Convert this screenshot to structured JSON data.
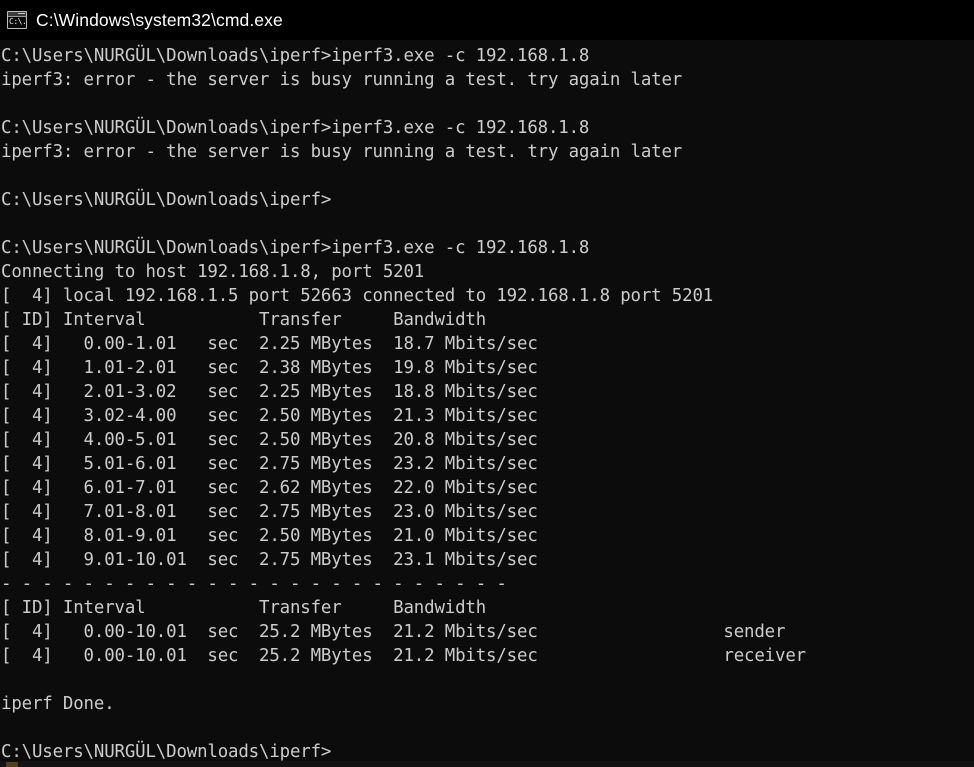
{
  "window": {
    "title": "C:\\Windows\\system32\\cmd.exe",
    "icon": "cmd-console-icon",
    "icon_glyph": "C:\\.",
    "titlebar_bg": "#000000",
    "console_bg": "#0c0c0c",
    "console_fg": "#cccccc"
  },
  "console": {
    "prompt": "C:\\Users\\NURGÜL\\Downloads\\iperf>",
    "command": "iperf3.exe -c 192.168.1.8",
    "lines": [
      "C:\\Users\\NURGÜL\\Downloads\\iperf>iperf3.exe -c 192.168.1.8",
      "iperf3: error - the server is busy running a test. try again later",
      "",
      "C:\\Users\\NURGÜL\\Downloads\\iperf>iperf3.exe -c 192.168.1.8",
      "iperf3: error - the server is busy running a test. try again later",
      "",
      "C:\\Users\\NURGÜL\\Downloads\\iperf>",
      "",
      "C:\\Users\\NURGÜL\\Downloads\\iperf>iperf3.exe -c 192.168.1.8",
      "Connecting to host 192.168.1.8, port 5201",
      "[  4] local 192.168.1.5 port 52663 connected to 192.168.1.8 port 5201",
      "[ ID] Interval           Transfer     Bandwidth",
      "[  4]   0.00-1.01   sec  2.25 MBytes  18.7 Mbits/sec",
      "[  4]   1.01-2.01   sec  2.38 MBytes  19.8 Mbits/sec",
      "[  4]   2.01-3.02   sec  2.25 MBytes  18.8 Mbits/sec",
      "[  4]   3.02-4.00   sec  2.50 MBytes  21.3 Mbits/sec",
      "[  4]   4.00-5.01   sec  2.50 MBytes  20.8 Mbits/sec",
      "[  4]   5.01-6.01   sec  2.75 MBytes  23.2 Mbits/sec",
      "[  4]   6.01-7.01   sec  2.62 MBytes  22.0 Mbits/sec",
      "[  4]   7.01-8.01   sec  2.75 MBytes  23.0 Mbits/sec",
      "[  4]   8.01-9.01   sec  2.50 MBytes  21.0 Mbits/sec",
      "[  4]   9.01-10.01  sec  2.75 MBytes  23.1 Mbits/sec",
      "- - - - - - - - - - - - - - - - - - - - - - - - -",
      "[ ID] Interval           Transfer     Bandwidth",
      "[  4]   0.00-10.01  sec  25.2 MBytes  21.2 Mbits/sec                  sender",
      "[  4]   0.00-10.01  sec  25.2 MBytes  21.2 Mbits/sec                  receiver",
      "",
      "iperf Done.",
      "",
      "C:\\Users\\NURGÜL\\Downloads\\iperf>"
    ]
  },
  "iperf_session": {
    "target_host": "192.168.1.8",
    "target_port": "5201",
    "local_host": "192.168.1.5",
    "local_port": "52663",
    "stream_id": "4",
    "error_message": "iperf3: error - the server is busy running a test. try again later",
    "error_count": 2,
    "done_message": "iperf Done.",
    "columns": [
      "ID",
      "Interval",
      "Transfer",
      "Bandwidth"
    ],
    "intervals": [
      {
        "id": "4",
        "interval": "0.00-1.01",
        "unit": "sec",
        "transfer": "2.25 MBytes",
        "bandwidth": "18.7 Mbits/sec"
      },
      {
        "id": "4",
        "interval": "1.01-2.01",
        "unit": "sec",
        "transfer": "2.38 MBytes",
        "bandwidth": "19.8 Mbits/sec"
      },
      {
        "id": "4",
        "interval": "2.01-3.02",
        "unit": "sec",
        "transfer": "2.25 MBytes",
        "bandwidth": "18.8 Mbits/sec"
      },
      {
        "id": "4",
        "interval": "3.02-4.00",
        "unit": "sec",
        "transfer": "2.50 MBytes",
        "bandwidth": "21.3 Mbits/sec"
      },
      {
        "id": "4",
        "interval": "4.00-5.01",
        "unit": "sec",
        "transfer": "2.50 MBytes",
        "bandwidth": "20.8 Mbits/sec"
      },
      {
        "id": "4",
        "interval": "5.01-6.01",
        "unit": "sec",
        "transfer": "2.75 MBytes",
        "bandwidth": "23.2 Mbits/sec"
      },
      {
        "id": "4",
        "interval": "6.01-7.01",
        "unit": "sec",
        "transfer": "2.62 MBytes",
        "bandwidth": "22.0 Mbits/sec"
      },
      {
        "id": "4",
        "interval": "7.01-8.01",
        "unit": "sec",
        "transfer": "2.75 MBytes",
        "bandwidth": "23.0 Mbits/sec"
      },
      {
        "id": "4",
        "interval": "8.01-9.01",
        "unit": "sec",
        "transfer": "2.50 MBytes",
        "bandwidth": "21.0 Mbits/sec"
      },
      {
        "id": "4",
        "interval": "9.01-10.01",
        "unit": "sec",
        "transfer": "2.75 MBytes",
        "bandwidth": "23.1 Mbits/sec"
      }
    ],
    "summary": [
      {
        "id": "4",
        "interval": "0.00-10.01",
        "unit": "sec",
        "transfer": "25.2 MBytes",
        "bandwidth": "21.2 Mbits/sec",
        "role": "sender"
      },
      {
        "id": "4",
        "interval": "0.00-10.01",
        "unit": "sec",
        "transfer": "25.2 MBytes",
        "bandwidth": "21.2 Mbits/sec",
        "role": "receiver"
      }
    ]
  }
}
